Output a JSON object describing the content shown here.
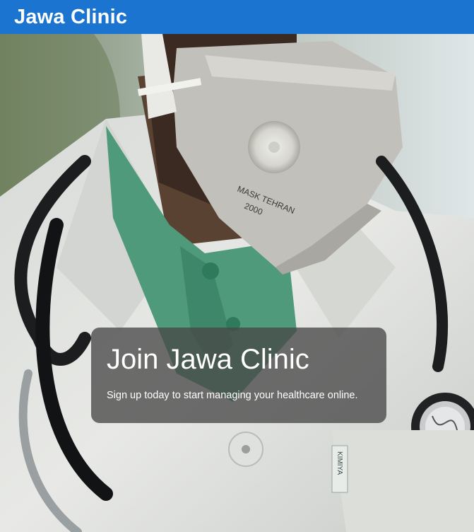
{
  "header": {
    "brand": "Jawa Clinic"
  },
  "hero": {
    "image_subject": "doctor-with-face-mask-and-stethoscope",
    "mask_text_line1": "MASK TEHRAN",
    "mask_text_line2": "2000",
    "badge_text": "KIMIYA"
  },
  "cta": {
    "title": "Join Jawa Clinic",
    "subtitle": "Sign up today to start managing your healthcare online."
  },
  "colors": {
    "header_bg": "#1b75d0",
    "header_text": "#ffffff",
    "card_bg": "rgba(72,72,72,0.78)",
    "coat": "#e3e5e3",
    "shirt": "#4f9a7a",
    "mask": "#bfbdb7"
  }
}
